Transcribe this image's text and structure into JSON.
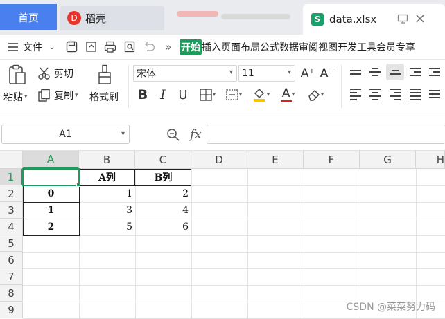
{
  "tabs": {
    "home": "首页",
    "daoke": "稻壳",
    "file": "data.xlsx",
    "daoke_logo": "D",
    "file_logo": "S"
  },
  "menu": {
    "file_label": "文件",
    "more": "»",
    "ribbon_tabs": [
      "开始",
      "插入",
      "页面布局",
      "公式",
      "数据",
      "审阅",
      "视图",
      "开发工具",
      "会员专享"
    ],
    "active_tab": "开始"
  },
  "ribbon": {
    "paste": "粘贴",
    "cut": "剪切",
    "copy": "复制",
    "format_painter": "格式刷",
    "font_name": "宋体",
    "font_size": "11",
    "bold": "B",
    "italic": "I",
    "underline": "U",
    "font_color": "A",
    "grow": "A⁺",
    "shrink": "A⁻",
    "accent_color": "#1e9c5b",
    "fill_color": "#f5c400",
    "text_color": "#e02020"
  },
  "formula_bar": {
    "cell_ref": "A1",
    "fx": "fx",
    "value": ""
  },
  "sheet": {
    "columns": [
      "A",
      "B",
      "C",
      "D",
      "E",
      "F",
      "G",
      "H"
    ],
    "rows": [
      "1",
      "2",
      "3",
      "4",
      "5",
      "6",
      "7",
      "8",
      "9"
    ],
    "header_row": [
      "",
      "A列",
      "B列"
    ],
    "data": [
      [
        "0",
        "1",
        "2"
      ],
      [
        "1",
        "3",
        "4"
      ],
      [
        "2",
        "5",
        "6"
      ]
    ],
    "selected_cell": "A1"
  },
  "watermark": "CSDN @菜菜努力码"
}
